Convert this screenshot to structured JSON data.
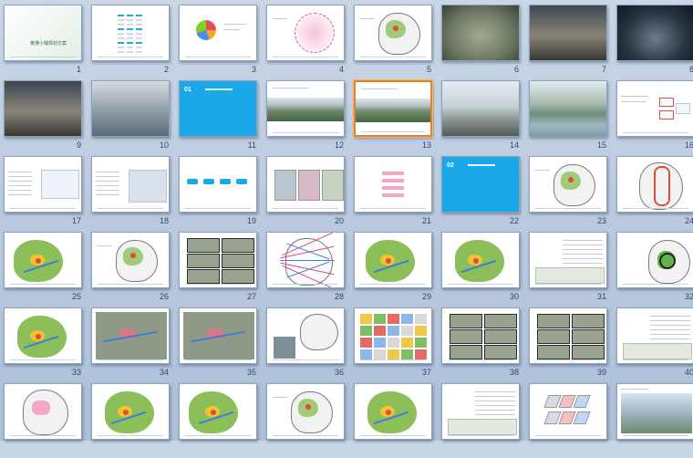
{
  "slide_sorter": {
    "selected_slide": "13",
    "section_01_label": "01",
    "section_02_label": "02",
    "cover_title": "黄港小镇规划方案",
    "slides": [
      {
        "number": "1"
      },
      {
        "number": "2"
      },
      {
        "number": "3"
      },
      {
        "number": "4"
      },
      {
        "number": "5"
      },
      {
        "number": "6"
      },
      {
        "number": "7"
      },
      {
        "number": "8"
      },
      {
        "number": "9"
      },
      {
        "number": "10"
      },
      {
        "number": "11"
      },
      {
        "number": "12"
      },
      {
        "number": "13"
      },
      {
        "number": "14"
      },
      {
        "number": "15"
      },
      {
        "number": "16"
      },
      {
        "number": "17"
      },
      {
        "number": "18"
      },
      {
        "number": "19"
      },
      {
        "number": "20"
      },
      {
        "number": "21"
      },
      {
        "number": "22"
      },
      {
        "number": "23"
      },
      {
        "number": "24"
      },
      {
        "number": "25"
      },
      {
        "number": "26"
      },
      {
        "number": "27"
      },
      {
        "number": "28"
      },
      {
        "number": "29"
      },
      {
        "number": "30"
      },
      {
        "number": "31"
      },
      {
        "number": "32"
      },
      {
        "number": "33"
      },
      {
        "number": "34"
      },
      {
        "number": "35"
      },
      {
        "number": "36"
      },
      {
        "number": "37"
      },
      {
        "number": "38"
      },
      {
        "number": "39"
      },
      {
        "number": "40"
      },
      {
        "number": ""
      },
      {
        "number": ""
      },
      {
        "number": ""
      },
      {
        "number": ""
      },
      {
        "number": ""
      },
      {
        "number": ""
      },
      {
        "number": ""
      },
      {
        "number": ""
      }
    ]
  },
  "colors": {
    "background": "#b9c9de",
    "section_blue": "#1ba8e8",
    "selection_orange": "#e0852b"
  }
}
